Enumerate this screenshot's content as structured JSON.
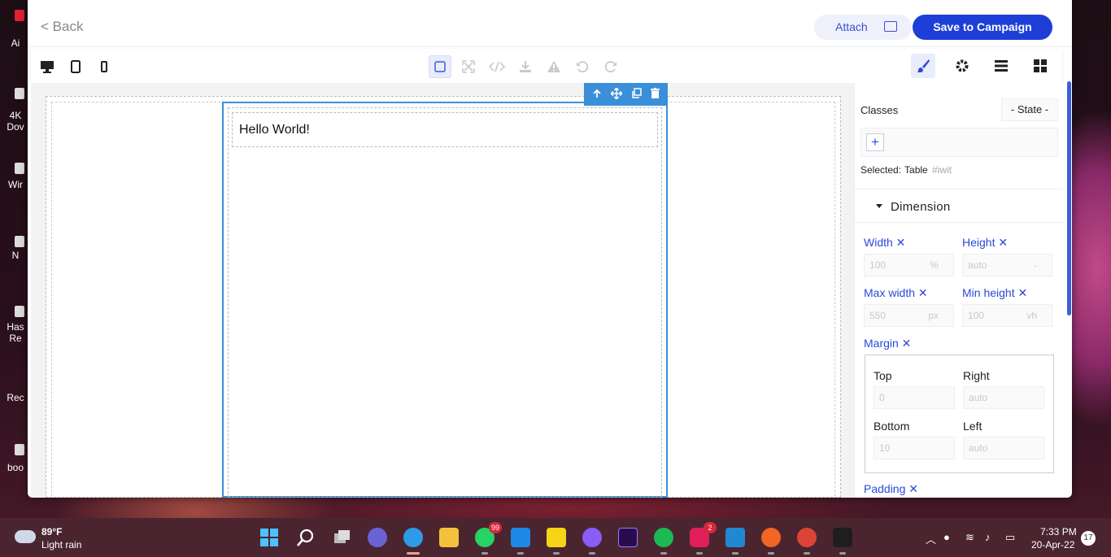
{
  "desktop": {
    "labels": [
      "Ai",
      "4K\nDov",
      "Wir",
      "N",
      "Has\nRe",
      "Rec",
      "boo"
    ]
  },
  "header": {
    "back_label": "< Back",
    "attach_label": "Attach",
    "save_label": "Save to Campaign"
  },
  "canvas": {
    "text": "Hello World!"
  },
  "panel": {
    "classes_label": "Classes",
    "state_label": "- State -",
    "add_class": "+",
    "selected_label": "Selected:",
    "selected_value": "Table",
    "selected_id": "#iwit",
    "sector_title": "Dimension",
    "width_label": "Width ✕",
    "width_value": "100",
    "width_unit": "%",
    "height_label": "Height ✕",
    "height_value": "auto",
    "height_unit": "-",
    "maxw_label": "Max width ✕",
    "maxw_value": "550",
    "maxw_unit": "px",
    "minh_label": "Min height ✕",
    "minh_value": "100",
    "minh_unit": "vh",
    "margin_label": "Margin ✕",
    "top_label": "Top",
    "top_value": "0",
    "right_label": "Right",
    "right_value": "auto",
    "bottom_label": "Bottom",
    "bottom_value": "10",
    "left_label": "Left",
    "left_value": "auto",
    "padding_label": "Padding ✕"
  },
  "taskbar": {
    "temp": "89°F",
    "condition": "Light rain",
    "whatsapp_badge": "99",
    "slack_badge": "2",
    "time": "7:33 PM",
    "date": "20-Apr-22",
    "notifications": "17"
  },
  "colors": {
    "accent": "#1d3fd8",
    "selection": "#3b8fd9"
  }
}
